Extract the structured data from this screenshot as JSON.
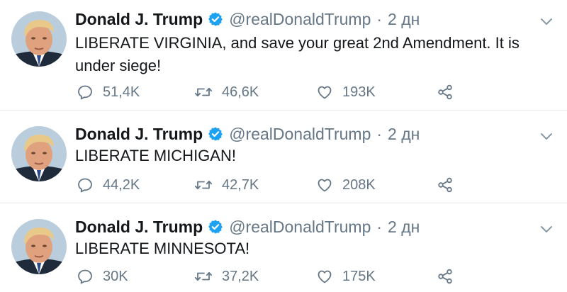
{
  "colors": {
    "text": "#14171a",
    "secondary": "#657786",
    "verified": "#1da1f2",
    "divider": "#e6ecf0"
  },
  "tweets": [
    {
      "name": "Donald J. Trump",
      "handle": "@realDonaldTrump",
      "separator": "·",
      "time": "2 дн",
      "text": "LIBERATE VIRGINIA, and save your great 2nd Amendment. It is under siege!",
      "replies": "51,4K",
      "retweets": "46,6K",
      "likes": "193K"
    },
    {
      "name": "Donald J. Trump",
      "handle": "@realDonaldTrump",
      "separator": "·",
      "time": "2 дн",
      "text": "LIBERATE MICHIGAN!",
      "replies": "44,2K",
      "retweets": "42,7K",
      "likes": "208K"
    },
    {
      "name": "Donald J. Trump",
      "handle": "@realDonaldTrump",
      "separator": "·",
      "time": "2 дн",
      "text": "LIBERATE MINNESOTA!",
      "replies": "30K",
      "retweets": "37,2K",
      "likes": "175K"
    }
  ],
  "icons": {
    "avatar": "profile-photo",
    "verified": "verified-badge-icon",
    "caret": "chevron-down-icon",
    "reply": "reply-icon",
    "retweet": "retweet-icon",
    "like": "heart-icon",
    "share": "share-icon"
  }
}
